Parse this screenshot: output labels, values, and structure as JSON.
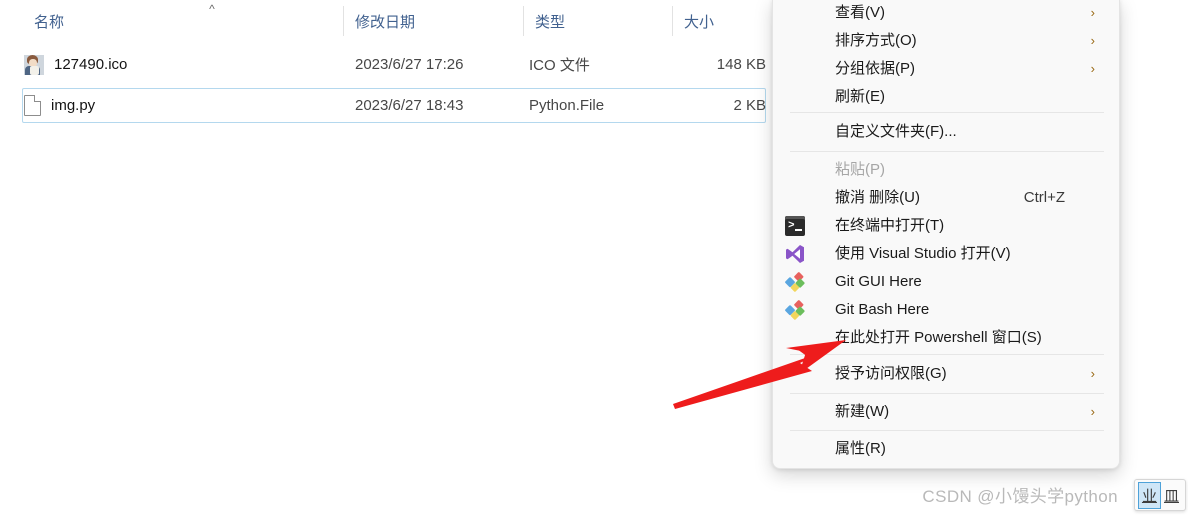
{
  "explorer": {
    "columns": [
      {
        "label": "名称",
        "sort_indicator": "^"
      },
      {
        "label": "修改日期",
        "sort_indicator": ""
      },
      {
        "label": "类型",
        "sort_indicator": ""
      },
      {
        "label": "大小",
        "sort_indicator": ""
      }
    ],
    "rows": [
      {
        "name": "127490.ico",
        "icon": "image-thumbnail-icon",
        "modified": "2023/6/27 17:26",
        "type": "ICO 文件",
        "size": "148 KB",
        "selected": "false"
      },
      {
        "name": "img.py",
        "icon": "generic-file-icon",
        "modified": "2023/6/27 18:43",
        "type": "Python.File",
        "size": "2 KB",
        "selected": "true"
      }
    ]
  },
  "context_menu": {
    "items": [
      {
        "label": "查看(V)",
        "icon": "",
        "accel": "",
        "submenu": "true",
        "disabled": "false"
      },
      {
        "label": "排序方式(O)",
        "icon": "",
        "accel": "",
        "submenu": "true",
        "disabled": "false"
      },
      {
        "label": "分组依据(P)",
        "icon": "",
        "accel": "",
        "submenu": "true",
        "disabled": "false"
      },
      {
        "label": "刷新(E)",
        "icon": "",
        "accel": "",
        "submenu": "false",
        "disabled": "false"
      },
      {
        "label": "自定义文件夹(F)...",
        "icon": "",
        "accel": "",
        "submenu": "false",
        "disabled": "false"
      },
      {
        "label": "粘贴(P)",
        "icon": "",
        "accel": "",
        "submenu": "false",
        "disabled": "true"
      },
      {
        "label": "撤消 删除(U)",
        "icon": "",
        "accel": "Ctrl+Z",
        "submenu": "false",
        "disabled": "false"
      },
      {
        "label": "在终端中打开(T)",
        "icon": "terminal-icon",
        "accel": "",
        "submenu": "false",
        "disabled": "false"
      },
      {
        "label": "使用 Visual Studio 打开(V)",
        "icon": "visual-studio-icon",
        "accel": "",
        "submenu": "false",
        "disabled": "false"
      },
      {
        "label": "Git GUI Here",
        "icon": "git-icon",
        "accel": "",
        "submenu": "false",
        "disabled": "false"
      },
      {
        "label": "Git Bash Here",
        "icon": "git-icon",
        "accel": "",
        "submenu": "false",
        "disabled": "false"
      },
      {
        "label": "在此处打开 Powershell 窗口(S)",
        "icon": "",
        "accel": "",
        "submenu": "false",
        "disabled": "false"
      },
      {
        "label": "授予访问权限(G)",
        "icon": "",
        "accel": "",
        "submenu": "true",
        "disabled": "false"
      },
      {
        "label": "新建(W)",
        "icon": "",
        "accel": "",
        "submenu": "true",
        "disabled": "false"
      },
      {
        "label": "属性(R)",
        "icon": "",
        "accel": "",
        "submenu": "false",
        "disabled": "false"
      }
    ],
    "submenu_arrow_glyph": "›"
  },
  "annotation": {
    "arrow_color": "#ee1c1c",
    "arrow_name": "red-pointer-arrow",
    "points_to": "在此处打开 Powershell 窗口(S)"
  },
  "watermark": {
    "text": "CSDN @小馒头学python"
  },
  "ime_overlay": {
    "cells": [
      {
        "text": "业",
        "selected": "true"
      },
      {
        "text": "皿",
        "selected": "false"
      }
    ]
  },
  "colors": {
    "header_text": "#41618f",
    "menu_bg": "#f9f9f9",
    "selection_border": "#b4d8ee",
    "submenu_arrow": "#9a6a16",
    "accent_red": "#ee1c1c"
  }
}
